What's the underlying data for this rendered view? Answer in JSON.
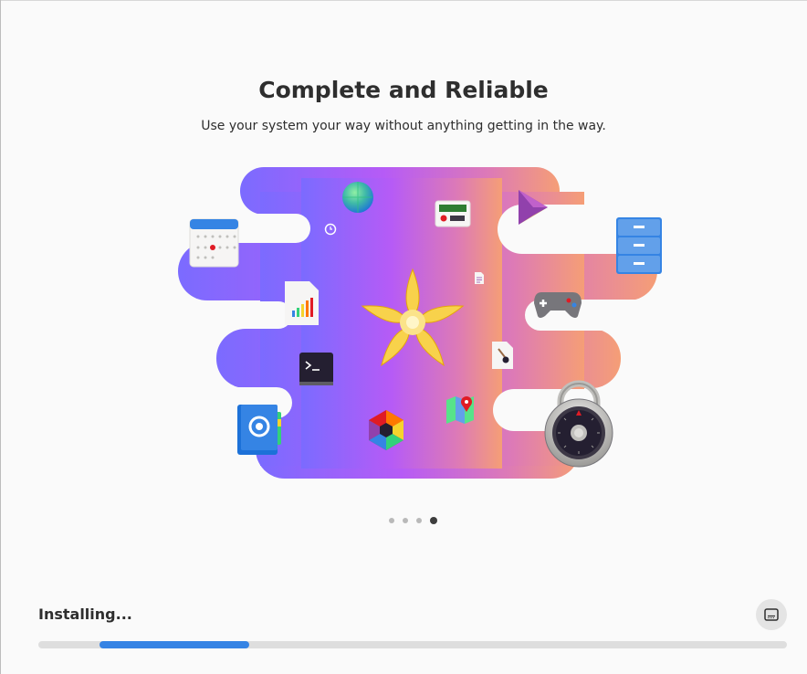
{
  "slide": {
    "title": "Complete and Reliable",
    "subtitle": "Use your system your way without anything getting in the way."
  },
  "carousel": {
    "page_count": 4,
    "current_page": 4
  },
  "installer": {
    "status_text": "Installing...",
    "progress_fraction": 0.2,
    "progress_offset_fraction": 0.082,
    "log_button_icon": "terminal-log-icon"
  },
  "colors": {
    "accent": "#3584e4",
    "gradient_start": "#7b6bff",
    "gradient_mid": "#b65bf6",
    "gradient_end": "#f59e76"
  },
  "icons": [
    "calendar-icon",
    "globe-icon",
    "clock-icon",
    "radio-icon",
    "video-player-icon",
    "file-cabinet-icon",
    "chart-document-icon",
    "text-document-icon",
    "games-icon",
    "terminal-icon",
    "flower-logo-icon",
    "brush-document-icon",
    "address-book-icon",
    "hex-app-icon",
    "maps-icon",
    "padlock-icon"
  ]
}
